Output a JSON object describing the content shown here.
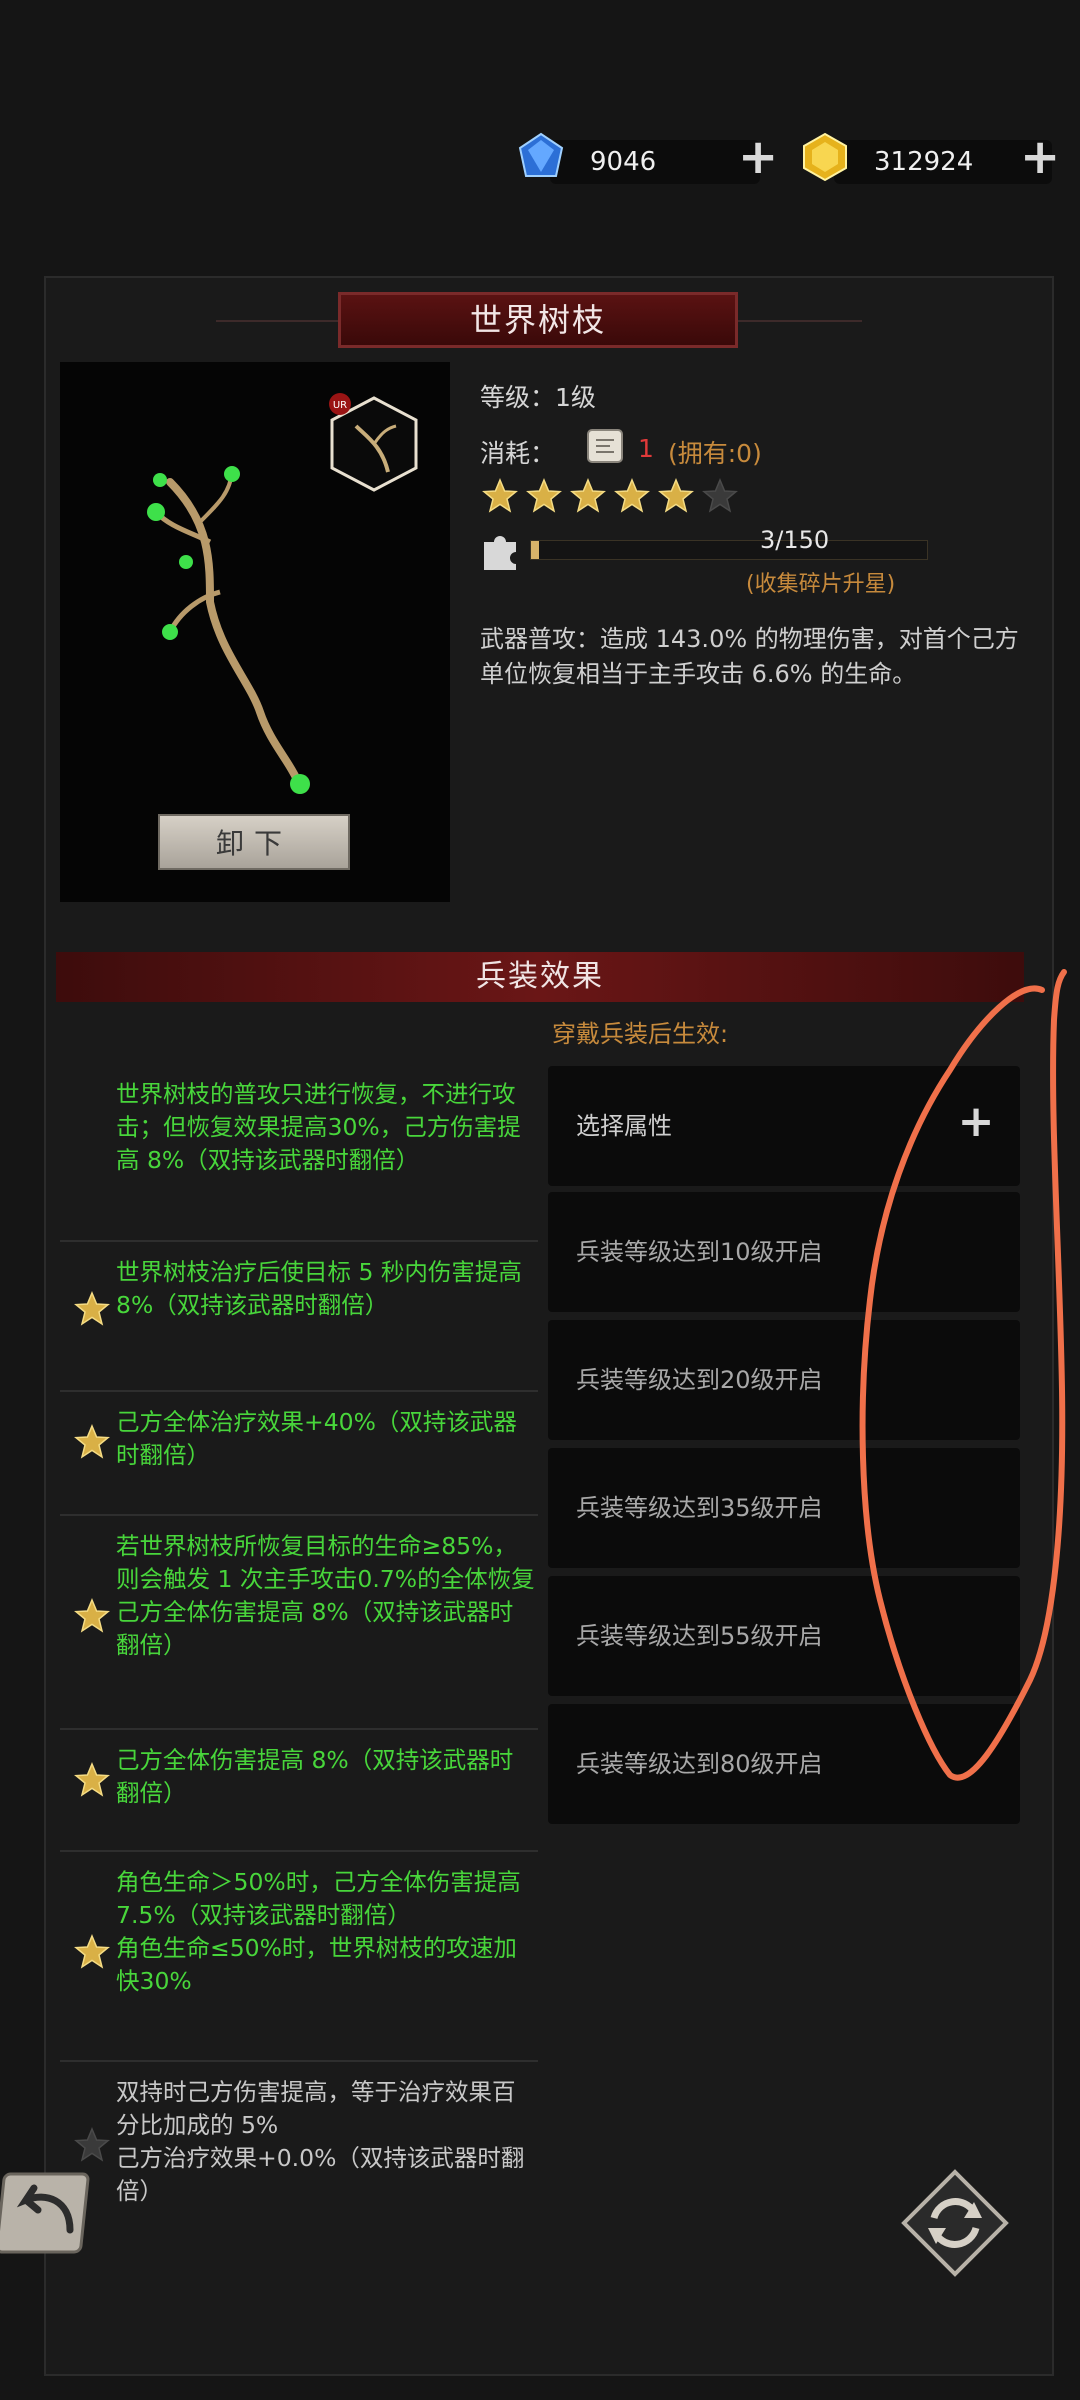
{
  "currency": {
    "gems": "9046",
    "gold": "312924"
  },
  "item": {
    "title": "世界树枝",
    "rarity_badge": "UR",
    "level_label": "等级：",
    "level_value": "1级",
    "cost_label": "消耗：",
    "cost_value": "1",
    "owned": "(拥有:0)",
    "stars_filled": 5,
    "stars_total": 6,
    "fragments": "3/150",
    "fragments_progress": 0.02,
    "fragments_hint": "(收集碎片升星)",
    "description": "武器普攻：造成 143.0% 的物理伤害，对首个己方单位恢复相当于主手攻击 6.6% 的生命。",
    "unequip_label": "卸下"
  },
  "effects": {
    "section_title": "兵装效果",
    "effective_hint": "穿戴兵装后生效:",
    "list": [
      {
        "text": "世界树枝的普攻只进行恢复，不进行攻击；但恢复效果提高30%，己方伤害提高 8%（双持该武器时翻倍）",
        "star": false
      },
      {
        "text": "世界树枝治疗后使目标 5 秒内伤害提高 8%（双持该武器时翻倍）",
        "star": true
      },
      {
        "text": "己方全体治疗效果+40%（双持该武器时翻倍）",
        "star": true
      },
      {
        "text": "若世界树枝所恢复目标的生命≥85%，则会触发 1 次主手攻击0.7%的全体恢复\n己方全体伤害提高 8%（双持该武器时翻倍）",
        "star": true
      },
      {
        "text": "己方全体伤害提高 8%（双持该武器时翻倍）",
        "star": true
      },
      {
        "text": "角色生命＞50%时，己方全体伤害提高 7.5%（双持该武器时翻倍）\n角色生命≤50%时，世界树枝的攻速加快30%",
        "star": true
      },
      {
        "text": "双持时己方伤害提高，等于治疗效果百分比加成的 5%\n己方治疗效果+0.0%（双持该武器时翻倍）",
        "star": false
      }
    ]
  },
  "slots": [
    {
      "label": "选择属性"
    },
    {
      "label": "兵装等级达到10级开启"
    },
    {
      "label": "兵装等级达到20级开启"
    },
    {
      "label": "兵装等级达到35级开启"
    },
    {
      "label": "兵装等级达到55级开启"
    },
    {
      "label": "兵装等级达到80级开启"
    }
  ],
  "colors": {
    "effect_green": "#48d63b",
    "annotation": "#f0704a",
    "accent_red": "#6a1616",
    "gold": "#d9b46a"
  },
  "icons": [
    "gem-icon",
    "gold-icon",
    "plus-icon",
    "star-icon",
    "puzzle-icon",
    "back-arrow-icon",
    "refresh-icon"
  ]
}
